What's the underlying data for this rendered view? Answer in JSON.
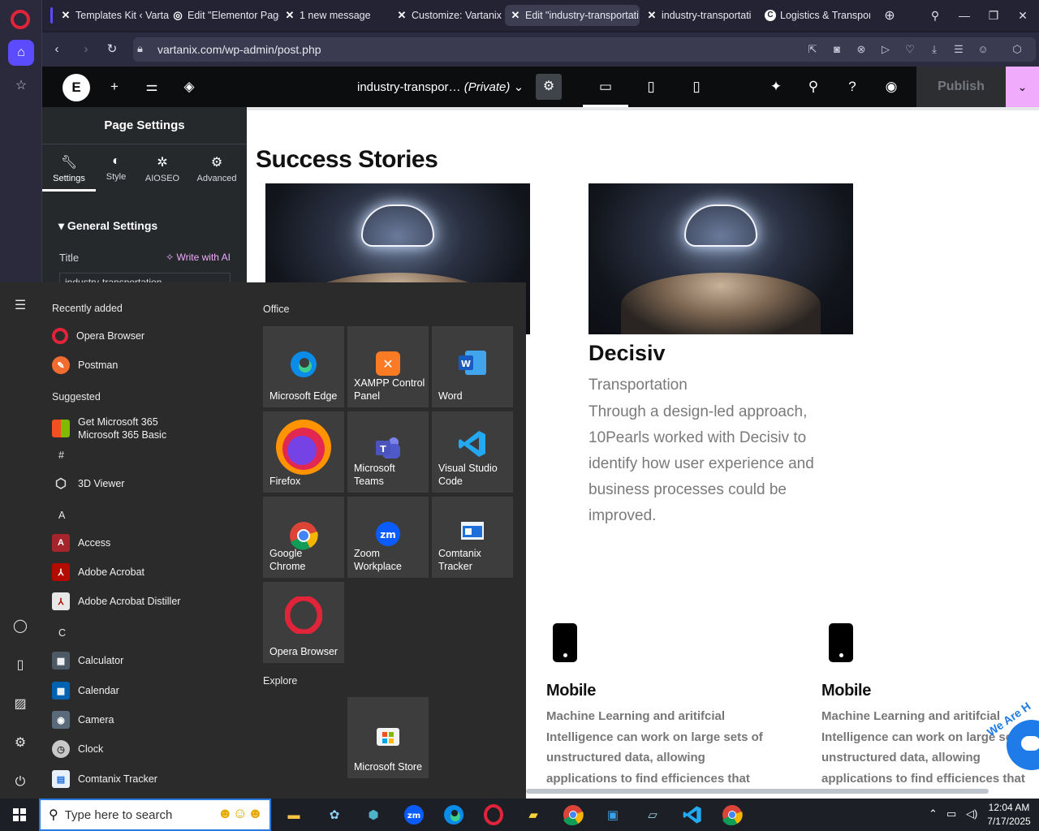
{
  "browser": {
    "tabs": [
      {
        "label": "Templates Kit ‹ Varta"
      },
      {
        "label": "Edit \"Elementor Page"
      },
      {
        "label": "1 new message"
      },
      {
        "label": "Customize: Vartanix"
      },
      {
        "label": "Edit \"industry-transportati"
      },
      {
        "label": "industry-transportati"
      },
      {
        "label": "Logistics & Transpor"
      }
    ],
    "url": "vartanix.com/wp-admin/post.php"
  },
  "elementor": {
    "page_title": "industry-transpor…",
    "page_status": "(Private)",
    "publish_label": "Publish",
    "panel": {
      "heading": "Page Settings",
      "tabs": [
        {
          "label": "Settings",
          "icon": "wrench-icon"
        },
        {
          "label": "Style",
          "icon": "half-circle-icon"
        },
        {
          "label": "AIOSEO",
          "icon": "aioseo-icon"
        },
        {
          "label": "Advanced",
          "icon": "gear-icon"
        }
      ],
      "section": "General Settings",
      "title_label": "Title",
      "ai_label": "Write with AI",
      "title_value": "industry-transportation"
    }
  },
  "canvas": {
    "section_title": "Success Stories",
    "story": {
      "name": "Decisiv",
      "category": "Transportation",
      "description": "Through a design-led approach, 10Pearls worked with Decisiv to identify how user experience and business processes could be improved."
    },
    "features": [
      {
        "title": "Mobile",
        "description": "Machine Learning and aritifcial Intelligence can work on large sets of unstructured data, allowing applications to find efficiences that"
      },
      {
        "title": "Mobile",
        "description": "Machine Learning and aritifcial Intelligence can work on large sets of unstructured data, allowing applications to find efficiences that"
      }
    ],
    "chat_badge": "We Are H"
  },
  "start_menu": {
    "recently_added_label": "Recently added",
    "recently_added": [
      {
        "label": "Opera Browser"
      },
      {
        "label": "Postman"
      }
    ],
    "suggested_label": "Suggested",
    "suggested": {
      "line1": "Get Microsoft 365",
      "line2": "Microsoft 365 Basic"
    },
    "letters": [
      "#",
      "A",
      "C"
    ],
    "apps": [
      {
        "label": "3D Viewer"
      },
      {
        "label": "Access"
      },
      {
        "label": "Adobe Acrobat"
      },
      {
        "label": "Adobe Acrobat Distiller"
      },
      {
        "label": "Calculator"
      },
      {
        "label": "Calendar"
      },
      {
        "label": "Camera"
      },
      {
        "label": "Clock"
      },
      {
        "label": "Comtanix Tracker"
      }
    ],
    "groups": {
      "office": "Office",
      "explore": "Explore"
    },
    "tiles": [
      {
        "label": "Microsoft Edge"
      },
      {
        "label": "XAMPP Control Panel"
      },
      {
        "label": "Word"
      },
      {
        "label": "Firefox"
      },
      {
        "label": "Microsoft Teams"
      },
      {
        "label": "Visual Studio Code"
      },
      {
        "label": "Google Chrome"
      },
      {
        "label": "Zoom Workplace"
      },
      {
        "label": "Comtanix Tracker"
      },
      {
        "label": "Opera Browser"
      },
      {
        "label": "Microsoft Store"
      }
    ]
  },
  "taskbar": {
    "search_placeholder": "Type here to search",
    "time": "12:04 AM",
    "date": "7/17/2025"
  },
  "colors": {
    "accent_opera": "#e2243a",
    "elementor_pink": "#f0abfc",
    "opera_active": "#5b4cff"
  }
}
